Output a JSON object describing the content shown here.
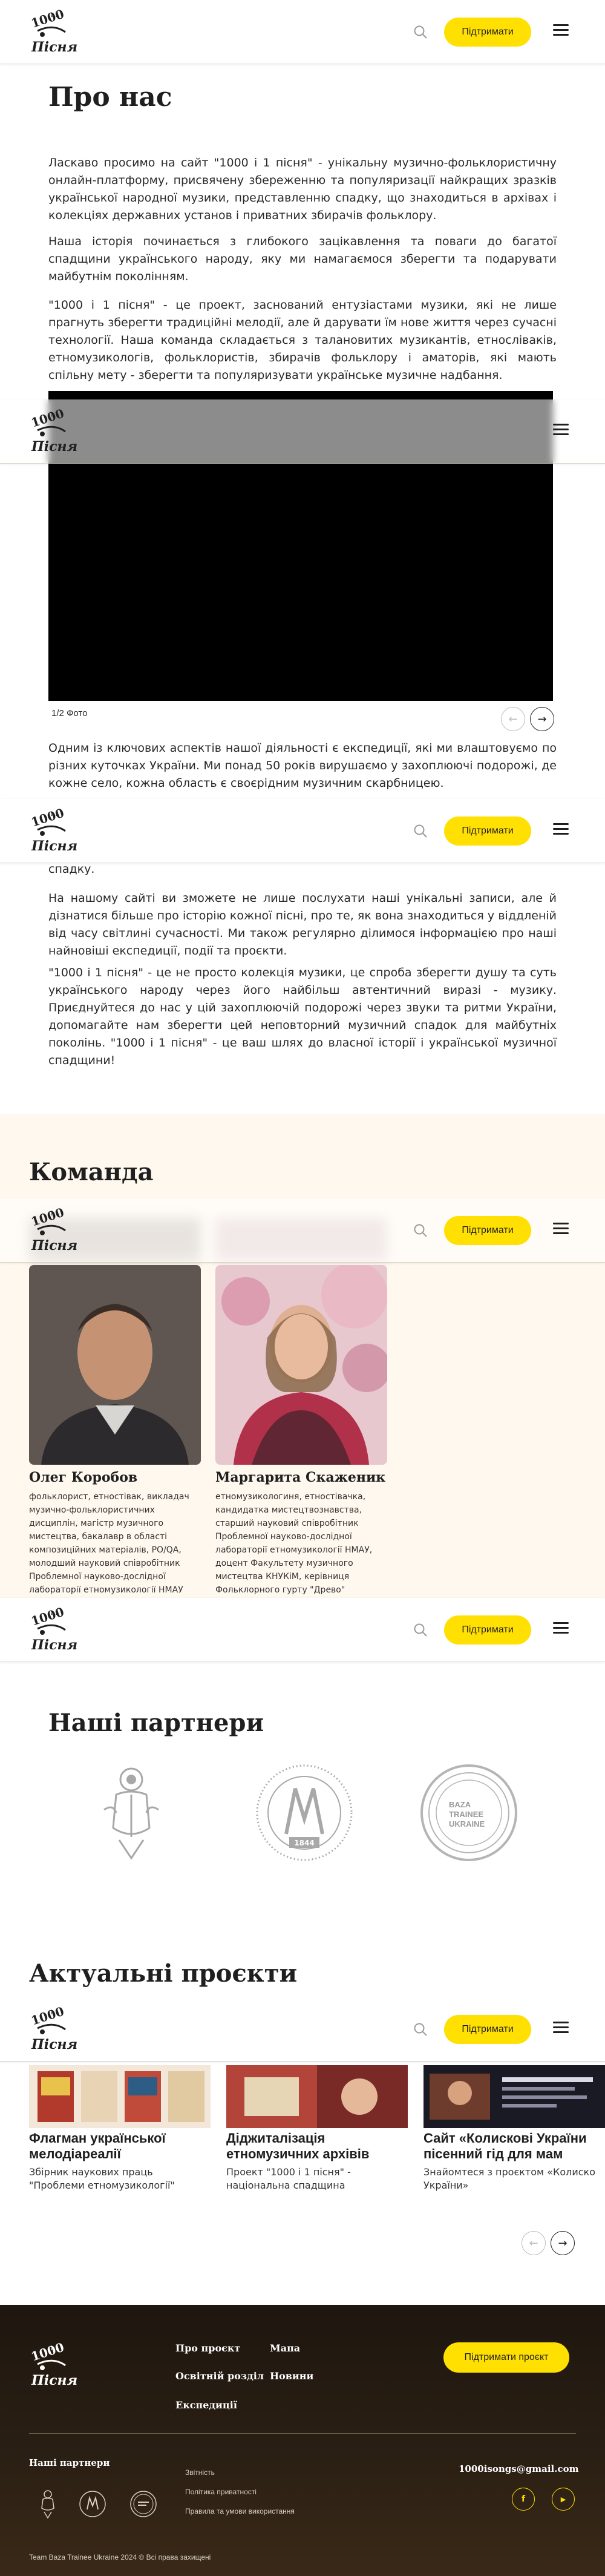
{
  "header": {
    "logo_alt": "1000 і 1 пісня",
    "donate_label": "Підтримати",
    "icons": {
      "search": "search-icon",
      "menu": "burger-menu-icon"
    }
  },
  "about": {
    "title": "Про нас",
    "p1": "Ласкаво просимо на сайт \"1000 і 1 пісня\" - унікальну музично-фольклористичну онлайн-платформу, присвячену збереженню та популяризації найкращих зразків української народної музики, представленню спадку, що знаходиться в архівах і колекціях державних установ і приватних збирачів фольклору.",
    "p2": "Наша історія починається з глибокого зацікавлення та поваги до багатої спадщини українського народу, яку ми намагаємося зберегти та подарувати майбутнім поколінням.",
    "p3": "\"1000 і 1 пісня\" - це проект, заснований ентузіастами музики, які не лише прагнуть зберегти традиційні мелодії, але й дарувати їм нове життя через сучасні технології. Наша команда складається з талановитих музикантів, етносліваків, етномузикологів, фольклористів, збирачів фольклору і аматорів, які мають спільну мету - зберегти та популяризувати українське музичне надбання.",
    "gallery_counter": "1/2 Фото",
    "p4": "Одним із ключових аспектів нашої діяльності є експедиції, які ми влаштовуємо по різних куточках України. Ми понад 50 років вирушаємо у захоплюючі подорожі, де кожне село, кожна область є своєрідним музичним скарбницею.",
    "p4_tail": "спадку.",
    "p5": "На нашому сайті ви зможете не лише послухати наші унікальні записи, але й дізнатися більше про історію кожної пісні, про те, як вона знаходиться у віддленій від часу світлині сучасності. Ми також регулярно ділимося інформацією про наші найновіші експедиції, події та проєкти.",
    "p6": "\"1000 і 1 пісня\" - це не просто колекція музики, це спроба зберегти душу та суть українського народу через його найбільш автентичний виразі - музику. Приєднуйтеся до нас у цій захоплюючій подорожі через звуки та ритми України, допомагайте нам зберегти цей неповторний музичний спадок для майбутніх поколінь. \"1000 і 1 пісня\" - це ваш шлях до власної історії і української музичної спадщини!"
  },
  "team": {
    "title": "Команда",
    "members": [
      {
        "name": "Олег Коробов",
        "desc": "фольклорист, етностівак, викладач музично-фольклористичних дисциплін, магістр музичного мистецтва, бакалавр в області композиційних матеріалів, РО/QA, молодший науковий співробітник Проблемної науково-дослідної лабораторії етномузикології НМАУ"
      },
      {
        "name": "Маргарита Скаженик",
        "desc": "етномузикологиня, етностівачка, кандидатка мистецтвознавства, старший науковий співробітник Проблемної науково-дослідної лабораторії етномузикології НМАУ, доцент Факультету музичного мистецтва КНУКіМ, керівниця Фольклорного гурту \"Древо\""
      }
    ]
  },
  "partners": {
    "title": "Наші партнери",
    "logos": [
      "partner-emblem-icon",
      "academy-seal-icon",
      "baza-trainee-ukraine-logo"
    ],
    "baza_text": "BAZA TRAINEE UKRAINE",
    "seal_year": "1844"
  },
  "projects": {
    "title": "Актуальні проєкти",
    "items": [
      {
        "title": "Флагман української мелодіареалії",
        "desc": "Збірник наукових праць \"Проблеми етномузикології\""
      },
      {
        "title": "Діджиталізація етномузичних архівів",
        "desc": "Проект \"1000 і 1 пісня\" - національна спадщина"
      },
      {
        "title": "Сайт «Колискові України пісенний гід для мам",
        "desc": "Знайомтеся з проєктом «Колиско України»"
      }
    ]
  },
  "footer": {
    "links": [
      "Про проєкт",
      "Освітній розділ",
      "Експедиції",
      "Мапа",
      "Новини"
    ],
    "donate_project_label": "Підтримати проєкт",
    "partners_label": "Наші партнери",
    "small_links": [
      "Звітність",
      "Політика приватності",
      "Правила та умови використання"
    ],
    "email": "1000isongs@gmail.com",
    "copyright": "Team Baza Trainee Ukraine 2024 © Всі права захищені",
    "social": [
      {
        "name": "facebook-icon",
        "glyph": "f"
      },
      {
        "name": "youtube-icon",
        "glyph": "▶"
      }
    ]
  },
  "colors": {
    "accent": "#ffe000",
    "team_bg": "#fff8ee",
    "footer_bg": "#2a1f14"
  }
}
